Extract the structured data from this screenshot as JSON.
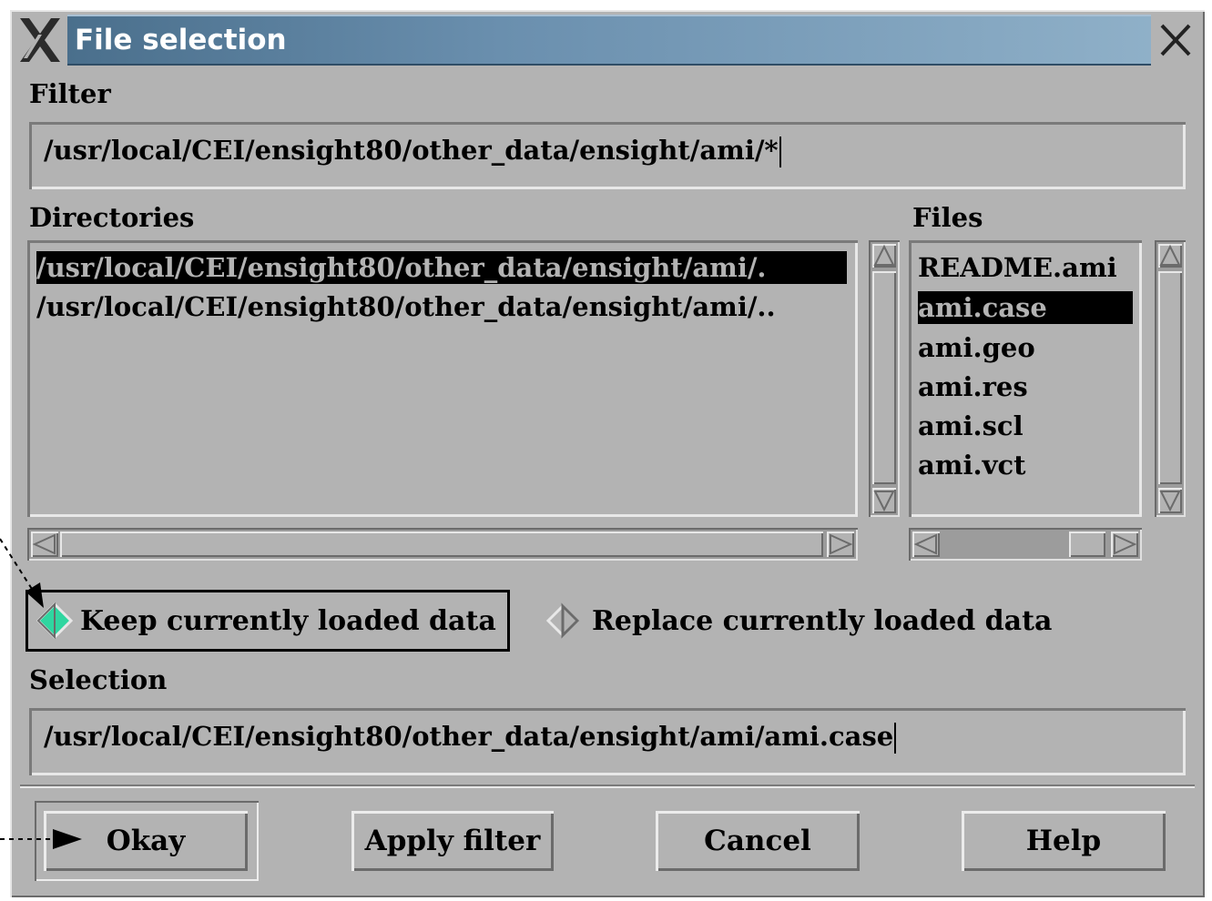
{
  "window": {
    "title": "File selection"
  },
  "filter": {
    "label": "Filter",
    "value": "/usr/local/CEI/ensight80/other_data/ensight/ami/*"
  },
  "directories": {
    "label": "Directories",
    "items": [
      {
        "label": "/usr/local/CEI/ensight80/other_data/ensight/ami/.",
        "selected": true
      },
      {
        "label": "/usr/local/CEI/ensight80/other_data/ensight/ami/..",
        "selected": false
      }
    ]
  },
  "files": {
    "label": "Files",
    "items": [
      {
        "label": "README.ami",
        "selected": false
      },
      {
        "label": "ami.case",
        "selected": true
      },
      {
        "label": "ami.geo",
        "selected": false
      },
      {
        "label": "ami.res",
        "selected": false
      },
      {
        "label": "ami.scl",
        "selected": false
      },
      {
        "label": "ami.vct",
        "selected": false
      }
    ]
  },
  "options": {
    "keep": {
      "label": "Keep currently loaded data",
      "checked": true
    },
    "replace": {
      "label": "Replace currently loaded data",
      "checked": false
    }
  },
  "selection": {
    "label": "Selection",
    "value": "/usr/local/CEI/ensight80/other_data/ensight/ami/ami.case"
  },
  "buttons": {
    "okay": "Okay",
    "apply": "Apply filter",
    "cancel": "Cancel",
    "help": "Help"
  },
  "colors": {
    "accent": "#2fd6a0",
    "titlebar": "#5b7f9c"
  }
}
